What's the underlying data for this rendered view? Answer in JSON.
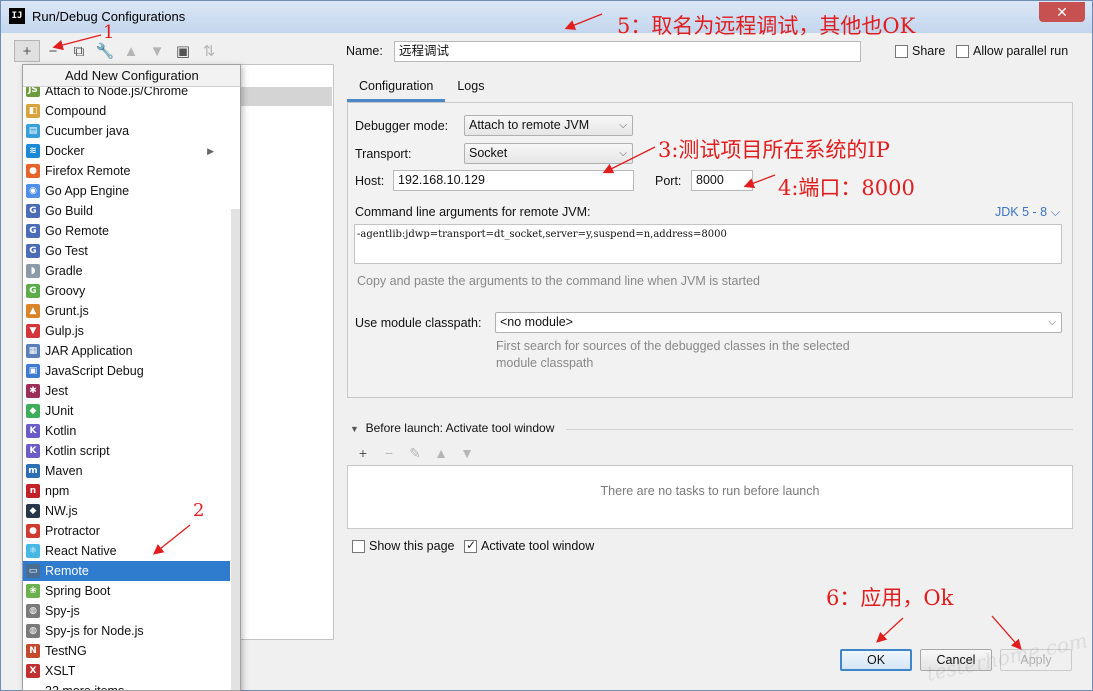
{
  "window": {
    "title": "Run/Debug Configurations",
    "app_icon": "IJ",
    "close_symbol": "✕"
  },
  "left_toolbar": [
    {
      "name": "add-icon",
      "symbol": "+"
    },
    {
      "name": "remove-icon",
      "symbol": "−"
    },
    {
      "name": "copy-icon",
      "symbol": "⧉"
    },
    {
      "name": "wrench-icon",
      "symbol": "🔧"
    },
    {
      "name": "move-up-icon",
      "symbol": "▲"
    },
    {
      "name": "move-down-icon",
      "symbol": "▼"
    },
    {
      "name": "folder-icon",
      "symbol": "▣"
    },
    {
      "name": "sort-icon",
      "symbol": "⇅"
    }
  ],
  "popup": {
    "header": "Add New Configuration",
    "partial_item": "Attach to Node.js/Chrome",
    "items": [
      {
        "label": "Compound",
        "icon": "compound-icon",
        "color": "#d9a33b",
        "glyph": "◧"
      },
      {
        "label": "Cucumber java",
        "icon": "cucumber-icon",
        "color": "#38a0d8",
        "glyph": "▤"
      },
      {
        "label": "Docker",
        "icon": "docker-icon",
        "color": "#1a8ad6",
        "glyph": "≋",
        "submenu": "▶"
      },
      {
        "label": "Firefox Remote",
        "icon": "firefox-icon",
        "color": "#e8632a",
        "glyph": "●"
      },
      {
        "label": "Go App Engine",
        "icon": "go-app-engine-icon",
        "color": "#4f8fe7",
        "glyph": "◉"
      },
      {
        "label": "Go Build",
        "icon": "go-build-icon",
        "color": "#4b6cb7",
        "glyph": "G"
      },
      {
        "label": "Go Remote",
        "icon": "go-remote-icon",
        "color": "#4b6cb7",
        "glyph": "G"
      },
      {
        "label": "Go Test",
        "icon": "go-test-icon",
        "color": "#4b6cb7",
        "glyph": "G"
      },
      {
        "label": "Gradle",
        "icon": "gradle-icon",
        "color": "#8b9aa8",
        "glyph": "◗"
      },
      {
        "label": "Groovy",
        "icon": "groovy-icon",
        "color": "#5cad4a",
        "glyph": "G"
      },
      {
        "label": "Grunt.js",
        "icon": "grunt-icon",
        "color": "#d9862a",
        "glyph": "▲"
      },
      {
        "label": "Gulp.js",
        "icon": "gulp-icon",
        "color": "#d3363a",
        "glyph": "▼"
      },
      {
        "label": "JAR Application",
        "icon": "jar-icon",
        "color": "#5a7fb8",
        "glyph": "▦"
      },
      {
        "label": "JavaScript Debug",
        "icon": "javascript-debug-icon",
        "color": "#3d7bd0",
        "glyph": "▣"
      },
      {
        "label": "Jest",
        "icon": "jest-icon",
        "color": "#9b2f58",
        "glyph": "✱"
      },
      {
        "label": "JUnit",
        "icon": "junit-icon",
        "color": "#3fae5c",
        "glyph": "◆"
      },
      {
        "label": "Kotlin",
        "icon": "kotlin-icon",
        "color": "#6b5cc7",
        "glyph": "K"
      },
      {
        "label": "Kotlin script",
        "icon": "kotlin-script-icon",
        "color": "#6b5cc7",
        "glyph": "K"
      },
      {
        "label": "Maven",
        "icon": "maven-icon",
        "color": "#2c6fb5",
        "glyph": "m"
      },
      {
        "label": "npm",
        "icon": "npm-icon",
        "color": "#c12127",
        "glyph": "n"
      },
      {
        "label": "NW.js",
        "icon": "nwjs-icon",
        "color": "#26364a",
        "glyph": "◆"
      },
      {
        "label": "Protractor",
        "icon": "protractor-icon",
        "color": "#d03a2f",
        "glyph": "●"
      },
      {
        "label": "React Native",
        "icon": "react-native-icon",
        "color": "#45b8e4",
        "glyph": "⚛"
      },
      {
        "label": "Remote",
        "icon": "remote-icon",
        "color": "#4a6d93",
        "glyph": "▭",
        "selected": true
      },
      {
        "label": "Spring Boot",
        "icon": "spring-boot-icon",
        "color": "#6ab04c",
        "glyph": "❀"
      },
      {
        "label": "Spy-js",
        "icon": "spy-js-icon",
        "color": "#7a7a7a",
        "glyph": "◍"
      },
      {
        "label": "Spy-js for Node.js",
        "icon": "spy-js-node-icon",
        "color": "#7a7a7a",
        "glyph": "◍"
      },
      {
        "label": "TestNG",
        "icon": "testng-icon",
        "color": "#c34a2c",
        "glyph": "N"
      },
      {
        "label": "XSLT",
        "icon": "xslt-icon",
        "color": "#c03030",
        "glyph": "X"
      }
    ],
    "more": "32 more items..."
  },
  "name_field": {
    "label": "Name:",
    "value": "远程调试"
  },
  "share": {
    "label": "Share",
    "checked": false
  },
  "allow_parallel": {
    "label": "Allow parallel run",
    "checked": false
  },
  "tabs": [
    {
      "label": "Configuration",
      "active": true
    },
    {
      "label": "Logs",
      "active": false
    }
  ],
  "config": {
    "debugger_mode_label": "Debugger mode:",
    "debugger_mode_value": "Attach to remote JVM",
    "transport_label": "Transport:",
    "transport_value": "Socket",
    "host_label": "Host:",
    "host_value": "192.168.10.129",
    "port_label": "Port:",
    "port_value": "8000",
    "cmd_label": "Command line arguments for remote JVM:",
    "jdk_label": "JDK 5 - 8",
    "cmd_value": "-agentlib:jdwp=transport=dt_socket,server=y,suspend=n,address=8000",
    "cmd_hint": "Copy and paste the arguments to the command line when JVM is started",
    "module_label": "Use module classpath:",
    "module_value": "<no module>",
    "module_hint_1": "First search for sources of the debugged classes in the selected",
    "module_hint_2": "module classpath"
  },
  "before_launch": {
    "title": "Before launch: Activate tool window",
    "empty_text": "There are no tasks to run before launch"
  },
  "show_page": {
    "label": "Show this page",
    "checked": false
  },
  "activate_tool": {
    "label": "Activate tool window",
    "checked": true
  },
  "buttons": {
    "ok": "OK",
    "cancel": "Cancel",
    "apply": "Apply"
  },
  "annotations": {
    "a1": "1",
    "a2": "2",
    "a3": "3:测试项目所在系统的IP",
    "a4": "4:端口：8000",
    "a5": "5：取名为远程调试，其他也OK",
    "a6": "6：应用，Ok"
  },
  "colors": {
    "annotation": "#e11d1d",
    "selection": "#2f7ccf",
    "tab_accent": "#4a88c7",
    "link": "#3a75c4"
  }
}
